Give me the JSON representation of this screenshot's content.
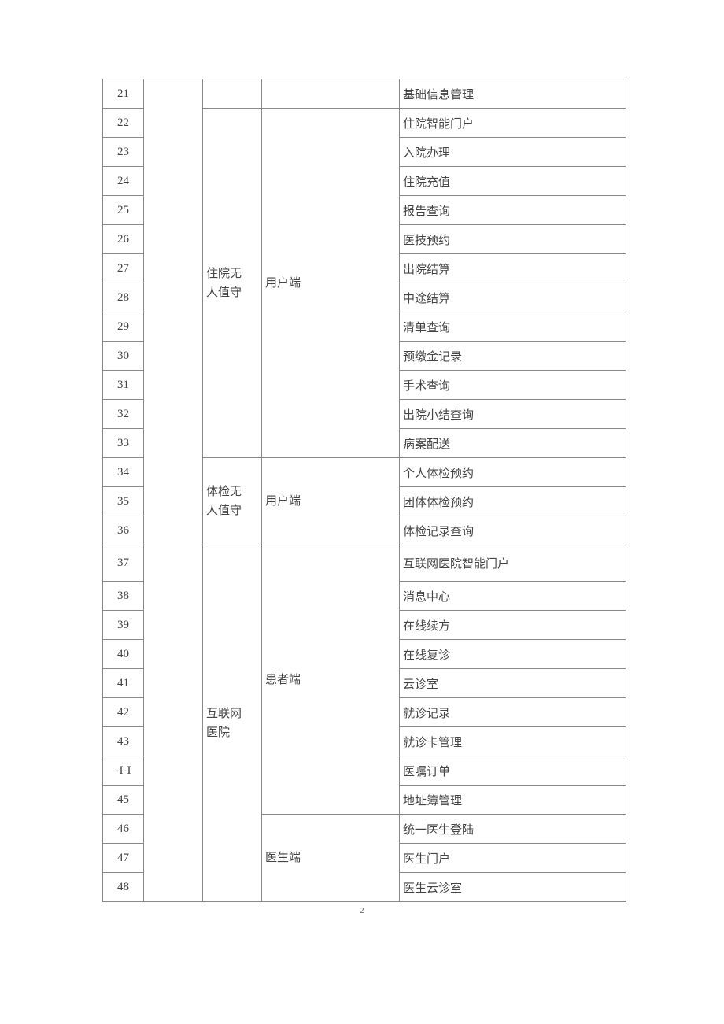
{
  "page_number": "2",
  "rows": [
    {
      "idx": "21",
      "cat": "",
      "sub": "",
      "item": "基础信息管理"
    },
    {
      "idx": "22",
      "item": "住院智能门户"
    },
    {
      "idx": "23",
      "item": "入院办理"
    },
    {
      "idx": "24",
      "item": "住院充值"
    },
    {
      "idx": "25",
      "item": "报告查询"
    },
    {
      "idx": "26",
      "item": "医技预约"
    },
    {
      "idx": "27",
      "item": "出院结算"
    },
    {
      "idx": "28",
      "item": "中途结算"
    },
    {
      "idx": "29",
      "item": "清单查询"
    },
    {
      "idx": "30",
      "item": "预缴金记录"
    },
    {
      "idx": "31",
      "item": "手术查询"
    },
    {
      "idx": "32",
      "item": "出院小结查询"
    },
    {
      "idx": "33",
      "item": "病案配送"
    },
    {
      "idx": "34",
      "item": "个人体检预约"
    },
    {
      "idx": "35",
      "item": "团体体检预约"
    },
    {
      "idx": "36",
      "item": "体检记录查询"
    },
    {
      "idx": "37",
      "item": "互联网医院智能门户"
    },
    {
      "idx": "38",
      "item": "消息中心"
    },
    {
      "idx": "39",
      "item": "在线续方"
    },
    {
      "idx": "40",
      "item": "在线复诊"
    },
    {
      "idx": "41",
      "item": "云诊室"
    },
    {
      "idx": "42",
      "item": "就诊记录"
    },
    {
      "idx": "43",
      "item": "就诊卡管理"
    },
    {
      "idx": "-I-I",
      "item": "医嘱订单"
    },
    {
      "idx": "45",
      "item": "地址簿管理"
    },
    {
      "idx": "46",
      "item": "统一医生登陆"
    },
    {
      "idx": "47",
      "item": "医生门户"
    },
    {
      "idx": "48",
      "item": "医生云诊室"
    }
  ],
  "groups": {
    "row21_cat": "",
    "row21_sub": "",
    "zhuyuan_cat_l1": "住院无",
    "zhuyuan_cat_l2": "人值守",
    "zhuyuan_sub": "用户端",
    "tijian_cat_l1": "体检无",
    "tijian_cat_l2": "人值守",
    "tijian_sub": "用户端",
    "hulian_cat_l1": "互联网",
    "hulian_cat_l2": "医院",
    "hulian_sub1": "患者端",
    "hulian_sub2": "医生端"
  }
}
